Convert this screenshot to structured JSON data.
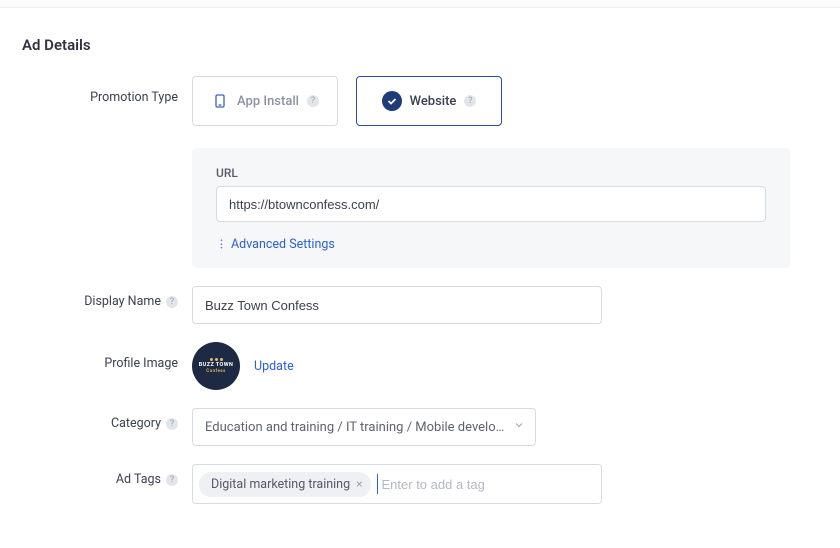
{
  "page": {
    "title": "Ad Details"
  },
  "labels": {
    "promotion_type": "Promotion Type",
    "display_name": "Display Name",
    "profile_image": "Profile Image",
    "category": "Category",
    "ad_tags": "Ad Tags"
  },
  "promotion": {
    "options": {
      "app_install": "App Install",
      "website": "Website"
    },
    "selected": "website"
  },
  "url_section": {
    "label": "URL",
    "value": "https://btownconfess.com/",
    "advanced_label": "Advanced Settings"
  },
  "display_name": {
    "value": "Buzz Town Confess"
  },
  "profile": {
    "update_label": "Update",
    "avatar_text_line1": "BUZZ TOWN",
    "avatar_text_line2": "Confess"
  },
  "category": {
    "display_text": "Education and training / IT training / Mobile developme..."
  },
  "tags": {
    "items": [
      "Digital marketing training"
    ],
    "placeholder": "Enter to add a tag"
  }
}
